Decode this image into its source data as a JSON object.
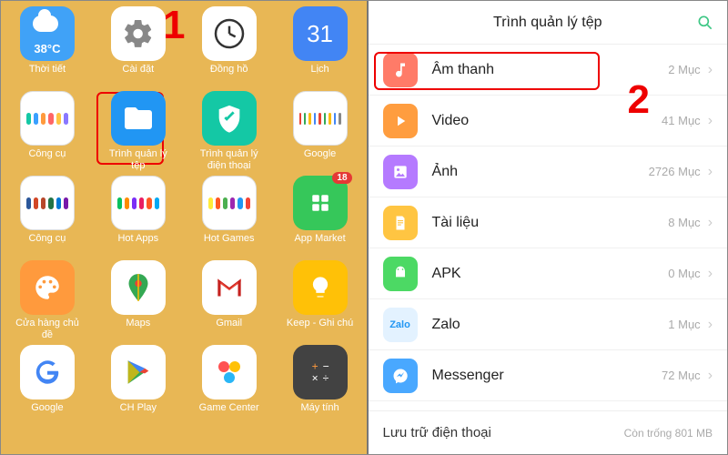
{
  "annotations": {
    "one": "1",
    "two": "2"
  },
  "left_apps": {
    "weather": {
      "label": "Thời tiết",
      "temp": "38°C"
    },
    "settings": {
      "label": "Cài đặt"
    },
    "clock": {
      "label": "Đồng hồ"
    },
    "calendar": {
      "label": "Lịch",
      "day": "31"
    },
    "tools": {
      "label": "Công cụ"
    },
    "filemgr": {
      "label": "Trình quản lý tệp"
    },
    "phonemgr": {
      "label": "Trình quản lý điện thoại"
    },
    "google_folder": {
      "label": "Google"
    },
    "tools2": {
      "label": "Công cụ"
    },
    "hotapps": {
      "label": "Hot Apps"
    },
    "hotgames": {
      "label": "Hot Games"
    },
    "appmarket": {
      "label": "App Market",
      "badge": "18"
    },
    "store": {
      "label": "Cửa hàng chủ đề"
    },
    "maps": {
      "label": "Maps"
    },
    "gmail": {
      "label": "Gmail"
    },
    "keep": {
      "label": "Keep - Ghi chú"
    },
    "google": {
      "label": "Google"
    },
    "chplay": {
      "label": "CH Play"
    },
    "gamecenter": {
      "label": "Game Center"
    },
    "calculator": {
      "label": "Máy tính"
    }
  },
  "right": {
    "title": "Trình quản lý tệp",
    "cats": [
      {
        "name": "Âm thanh",
        "count": "2 Mục",
        "color": "#ff7b68",
        "icon": "audio"
      },
      {
        "name": "Video",
        "count": "41 Mục",
        "color": "#ff9d3f",
        "icon": "video"
      },
      {
        "name": "Ảnh",
        "count": "2726 Mục",
        "color": "#b57aff",
        "icon": "image"
      },
      {
        "name": "Tài liệu",
        "count": "8 Mục",
        "color": "#ffc542",
        "icon": "doc"
      },
      {
        "name": "APK",
        "count": "0 Mục",
        "color": "#4cd964",
        "icon": "apk"
      },
      {
        "name": "Zalo",
        "count": "1 Mục",
        "color": "#e3f2ff",
        "icon": "zalo"
      },
      {
        "name": "Messenger",
        "count": "72 Mục",
        "color": "#49a8ff",
        "icon": "msgr"
      }
    ],
    "storage": {
      "title": "Lưu trữ điện thoại",
      "free": "Còn trống 801 MB"
    }
  }
}
